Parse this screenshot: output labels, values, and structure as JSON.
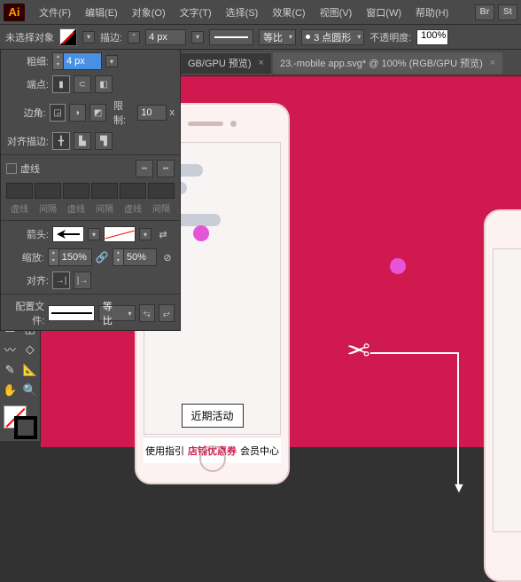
{
  "menubar": {
    "logo": "Ai",
    "items": [
      "文件(F)",
      "编辑(E)",
      "对象(O)",
      "文字(T)",
      "选择(S)",
      "效果(C)",
      "视图(V)",
      "窗口(W)",
      "帮助(H)"
    ],
    "right": [
      "Br",
      "St"
    ]
  },
  "optbar": {
    "no_selection": "未选择对象",
    "stroke_label": "描边:",
    "stroke_value": "4 px",
    "stroke_type": "等比",
    "brush_label": "3 点圆形",
    "opacity_label": "不透明度:",
    "opacity_value": "100%"
  },
  "tabs": [
    {
      "label": "GB/GPU 预览)",
      "close": "×"
    },
    {
      "label": "23.-mobile app.svg* @ 100% (RGB/GPU 预览)",
      "close": "×"
    }
  ],
  "panel": {
    "weight_label": "粗细:",
    "weight_value": "4 px",
    "cap_label": "端点:",
    "corner_label": "边角:",
    "limit_label": "限制:",
    "limit_value": "10",
    "limit_x": "x",
    "align_label": "对齐描边:",
    "dashed_label": "虚线",
    "dash_labels": [
      "虚线",
      "间隔",
      "虚线",
      "间隔",
      "虚线",
      "间隔"
    ],
    "arrow_label": "箭头:",
    "scale_label": "缩放:",
    "scale1": "150%",
    "scale2": "50%",
    "align2_label": "对齐:",
    "profile_label": "配置文件:",
    "profile_type": "等比"
  },
  "phone": {
    "promo": "近期活动",
    "nav": [
      "使用指引",
      "店铺优惠券",
      "会员中心"
    ]
  }
}
